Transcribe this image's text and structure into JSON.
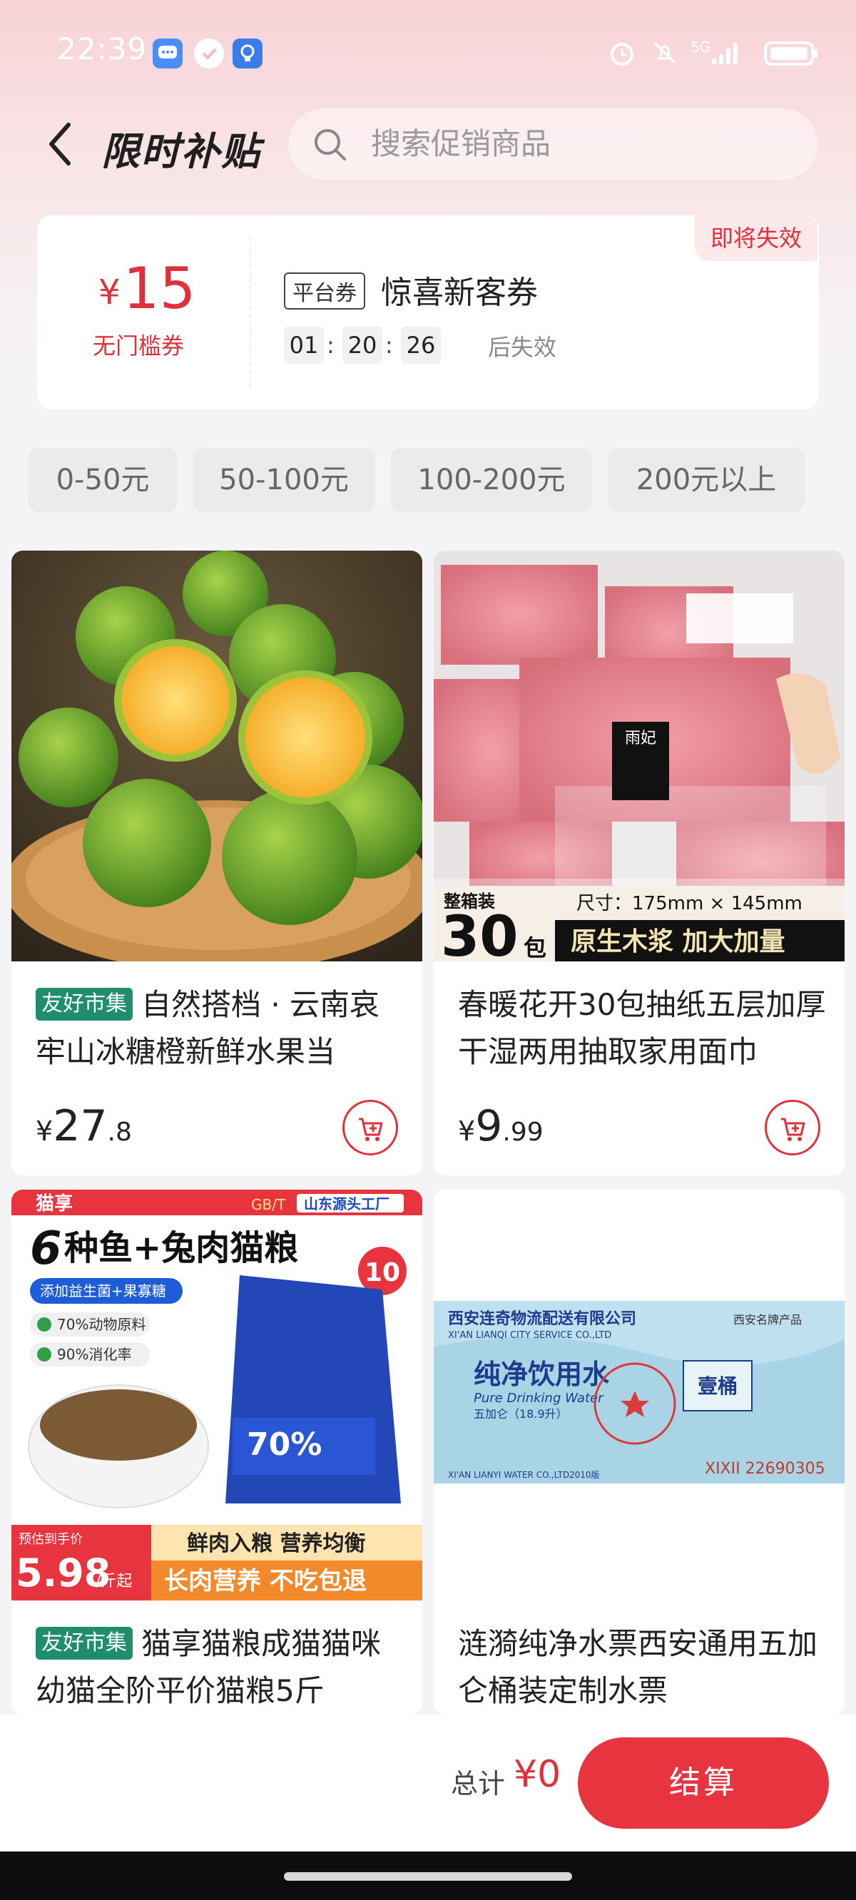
{
  "status_bar": {
    "time": "22:39",
    "network": "5G",
    "icons": [
      "message-icon",
      "shield-check-icon",
      "lightbulb-app-icon",
      "alarm-icon",
      "mute-icon",
      "signal-icon",
      "battery-icon"
    ]
  },
  "header": {
    "title": "限时补贴",
    "search_placeholder": "搜索促销商品"
  },
  "coupon": {
    "currency": "¥",
    "amount": "15",
    "type_desc": "无门槛券",
    "tag": "平台券",
    "name": "惊喜新客券",
    "countdown": [
      "01",
      "20",
      "26"
    ],
    "countdown_suffix": "后失效",
    "expire_badge": "即将失效"
  },
  "price_filters": [
    "0-50元",
    "50-100元",
    "100-200元",
    "200元以上"
  ],
  "products": [
    {
      "badge": "友好市集",
      "title": "自然搭档 · 云南哀牢山冰糖橙新鲜水果当",
      "currency": "¥",
      "price_int": "27",
      "price_dec": ".8"
    },
    {
      "badge": "",
      "title": "春暖花开30包抽纸五层加厚干湿两用抽取家用面巾",
      "currency": "¥",
      "price_int": "9",
      "price_dec": ".99",
      "image_text": {
        "pack_label": "整箱装",
        "pack_count": "30",
        "pack_unit": "包",
        "size": "尺寸：175mm × 145mm",
        "feature": "原生木浆 加大加量",
        "brand": "雨妃"
      }
    },
    {
      "badge": "友好市集",
      "title": "猫享猫粮成猫猫咪幼猫全阶平价猫粮5斤",
      "image_text": {
        "brand": "猫享",
        "std": "GB/T",
        "factory": "山东源头工厂",
        "headline_num": "6",
        "headline": "种鱼+兔肉猫粮",
        "tag": "10",
        "sub": "添加益生菌+果寡糖",
        "check1": "70%动物原料",
        "check2": "90%消化率",
        "est_label": "预估到手价",
        "est_price": "5.98",
        "est_unit": "/斤起",
        "slogan1": "鲜肉入粮  营养均衡",
        "slogan2": "长肉营养  不吃包退",
        "bag_pct": "70%"
      }
    },
    {
      "badge": "",
      "title": "涟漪纯净水票西安通用五加仑桶装定制水票",
      "image_text": {
        "company": "西安连奇物流配送有限公司",
        "company_en": "XI'AN LIANQI CITY SERVICE CO.,LTD",
        "brand_tag": "西安名牌产品",
        "product": "纯净饮用水",
        "product_en": "Pure Drinking Water",
        "volume": "五加仑（18.9升）",
        "unit": "壹桶",
        "serial": "XIXII  22690305",
        "footer": "XI'AN LIANYI WATER CO.,LTD",
        "year": "2010版"
      }
    }
  ],
  "bottom": {
    "total_label": "总计",
    "total_value": "¥0",
    "checkout": "结算"
  },
  "colors": {
    "accent": "#e0303c",
    "badge_green": "#1f8d6e",
    "chip_bg": "#ebebed"
  }
}
